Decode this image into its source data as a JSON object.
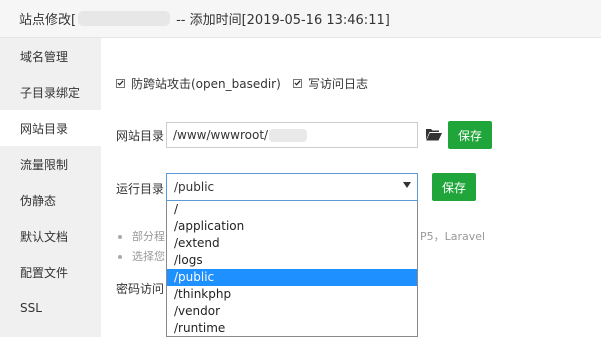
{
  "window": {
    "title_prefix": "站点修改[",
    "title_suffix": "-- 添加时间[2019-05-16 13:46:11]"
  },
  "sidebar": {
    "items": [
      {
        "label": "域名管理"
      },
      {
        "label": "子目录绑定"
      },
      {
        "label": "网站目录"
      },
      {
        "label": "流量限制"
      },
      {
        "label": "伪静态"
      },
      {
        "label": "默认文档"
      },
      {
        "label": "配置文件"
      },
      {
        "label": "SSL"
      }
    ]
  },
  "options": {
    "anti_xss_label": "防跨站攻击(open_basedir)",
    "anti_xss_checked": true,
    "access_log_label": "写访问日志",
    "access_log_checked": true
  },
  "site_dir": {
    "label": "网站目录",
    "value": "/www/wwwroot/",
    "save_label": "保存"
  },
  "run_dir": {
    "label": "运行目录",
    "selected": "/public",
    "save_label": "保存",
    "options": [
      "/",
      "/application",
      "/extend",
      "/logs",
      "/public",
      "/thinkphp",
      "/vendor",
      "/runtime"
    ]
  },
  "tips": {
    "tip1_start": "部分程",
    "tip1_end": "P5，Laravel",
    "tip2_start": "选择您"
  },
  "password": {
    "label": "密码访问"
  },
  "colors": {
    "accent_green": "#20a53a",
    "selection_blue": "#1e90ff"
  }
}
